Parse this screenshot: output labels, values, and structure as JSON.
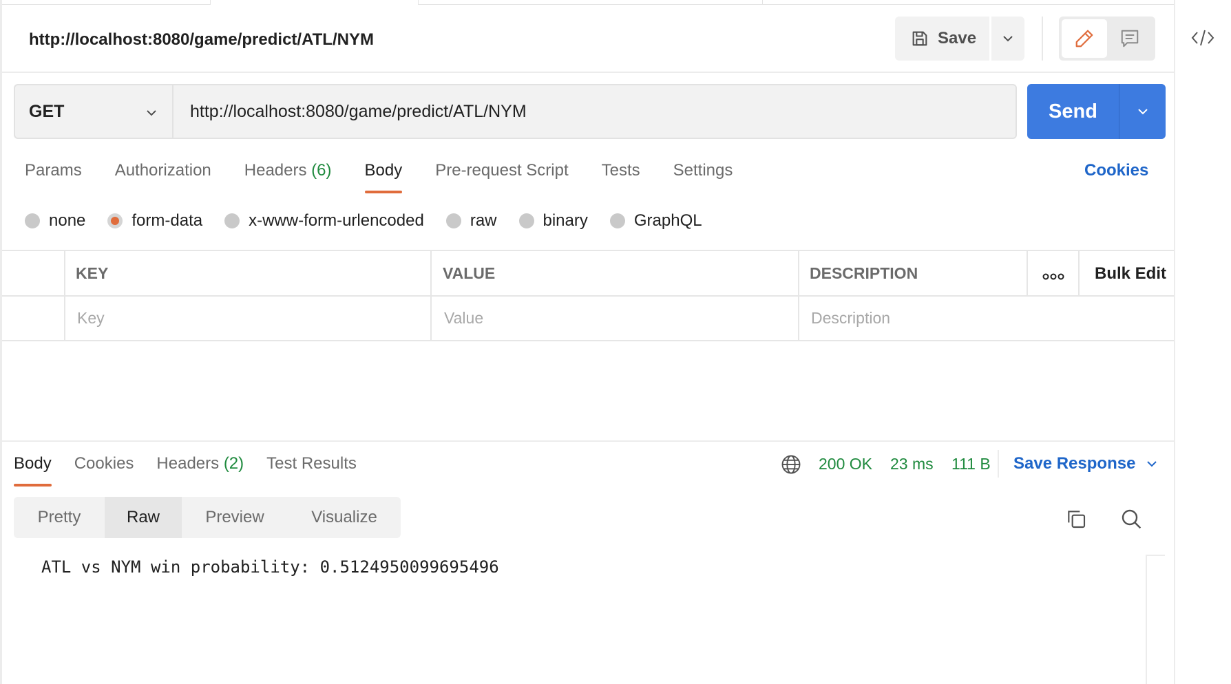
{
  "request": {
    "title": "http://localhost:8080/game/predict/ATL/NYM",
    "method": "GET",
    "url": "http://localhost:8080/game/predict/ATL/NYM"
  },
  "toolbar": {
    "save_label": "Save",
    "send_label": "Send"
  },
  "request_tabs": [
    {
      "label": "Params"
    },
    {
      "label": "Authorization"
    },
    {
      "label": "Headers",
      "count": "(6)"
    },
    {
      "label": "Body",
      "active": true
    },
    {
      "label": "Pre-request Script"
    },
    {
      "label": "Tests"
    },
    {
      "label": "Settings"
    }
  ],
  "cookies_label": "Cookies",
  "body_types": [
    {
      "label": "none"
    },
    {
      "label": "form-data",
      "selected": true
    },
    {
      "label": "x-www-form-urlencoded"
    },
    {
      "label": "raw"
    },
    {
      "label": "binary"
    },
    {
      "label": "GraphQL"
    }
  ],
  "kv_table": {
    "headers": {
      "key": "KEY",
      "value": "VALUE",
      "description": "DESCRIPTION"
    },
    "bulk_edit": "Bulk Edit",
    "placeholders": {
      "key": "Key",
      "value": "Value",
      "description": "Description"
    }
  },
  "response_tabs": [
    {
      "label": "Body",
      "active": true
    },
    {
      "label": "Cookies"
    },
    {
      "label": "Headers",
      "count": "(2)"
    },
    {
      "label": "Test Results"
    }
  ],
  "response_status": {
    "status": "200 OK",
    "time": "23 ms",
    "size": "111 B"
  },
  "save_response_label": "Save Response",
  "view_tabs": [
    {
      "label": "Pretty"
    },
    {
      "label": "Raw",
      "active": true
    },
    {
      "label": "Preview"
    },
    {
      "label": "Visualize"
    }
  ],
  "response_body": "ATL vs NYM win probability: 0.5124950099695496",
  "colors": {
    "accent": "#e06c3c",
    "send_blue": "#3d7be0",
    "link_blue": "#1f66c9",
    "status_green": "#1f8a3e"
  },
  "icons": [
    "save-icon",
    "chevron-down-icon",
    "pencil-icon",
    "comment-icon",
    "code-icon",
    "more-icon",
    "globe-icon",
    "copy-icon",
    "search-icon"
  ]
}
